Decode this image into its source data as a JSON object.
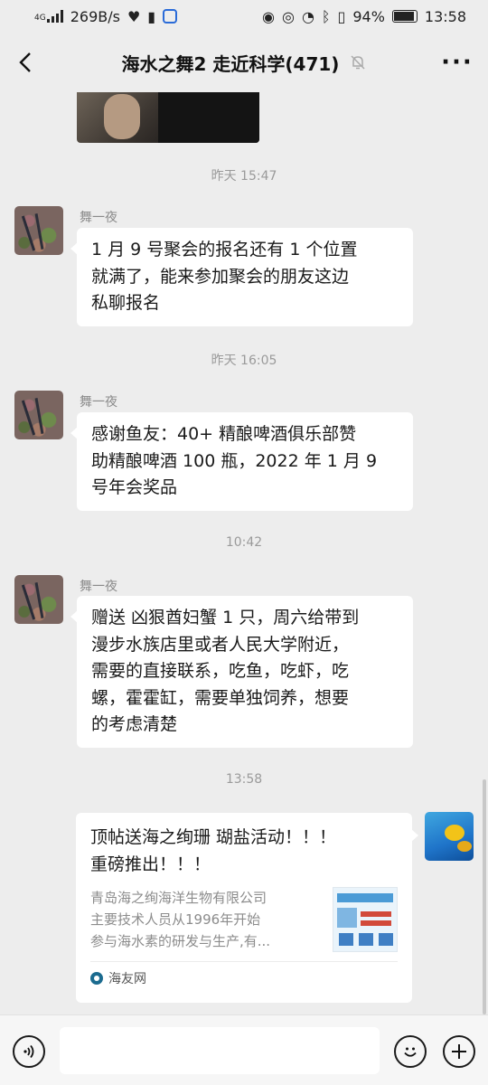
{
  "status_bar": {
    "network_type": "4G",
    "speed": "269B/s",
    "battery": "94%",
    "time": "13:58"
  },
  "header": {
    "title": "海水之舞2 走近科学(471)",
    "back_icon": "chevron-left-icon",
    "mute_icon": "bell-off-icon",
    "more_icon": "more-dots-icon"
  },
  "messages": [
    {
      "timestamp": "昨天 15:47",
      "sender": "舞一夜",
      "text_lines": [
        "1 月 9 号聚会的报名还有 1 个位置",
        "就满了，能来参加聚会的朋友这边",
        "私聊报名"
      ]
    },
    {
      "timestamp": "昨天 16:05",
      "sender": "舞一夜",
      "text_lines": [
        "感谢鱼友：40+ 精酿啤酒俱乐部赞",
        "助精酿啤酒 100 瓶，2022 年 1 月 9",
        "号年会奖品"
      ]
    },
    {
      "timestamp": "10:42",
      "sender": "舞一夜",
      "text_lines": [
        "赠送 凶狠酋妇蟹 1 只，周六给带到",
        "漫步水族店里或者人民大学附近，",
        "需要的直接联系，吃鱼，吃虾，吃",
        "螺，霍霍缸，需要单独饲养，想要",
        "的考虑清楚"
      ]
    }
  ],
  "shared_link": {
    "timestamp": "13:58",
    "title_lines": [
      "顶帖送海之绚珊 瑚盐活动！！！",
      "重磅推出！！！"
    ],
    "desc_lines": [
      "青岛海之绚海洋生物有限公司",
      "主要技术人员从1996年开始",
      "参与海水素的研发与生产,有..."
    ],
    "source": "海友网"
  },
  "input_bar": {
    "voice_icon": "voice-icon",
    "emoji_icon": "emoji-icon",
    "plus_icon": "plus-icon",
    "text_value": ""
  }
}
